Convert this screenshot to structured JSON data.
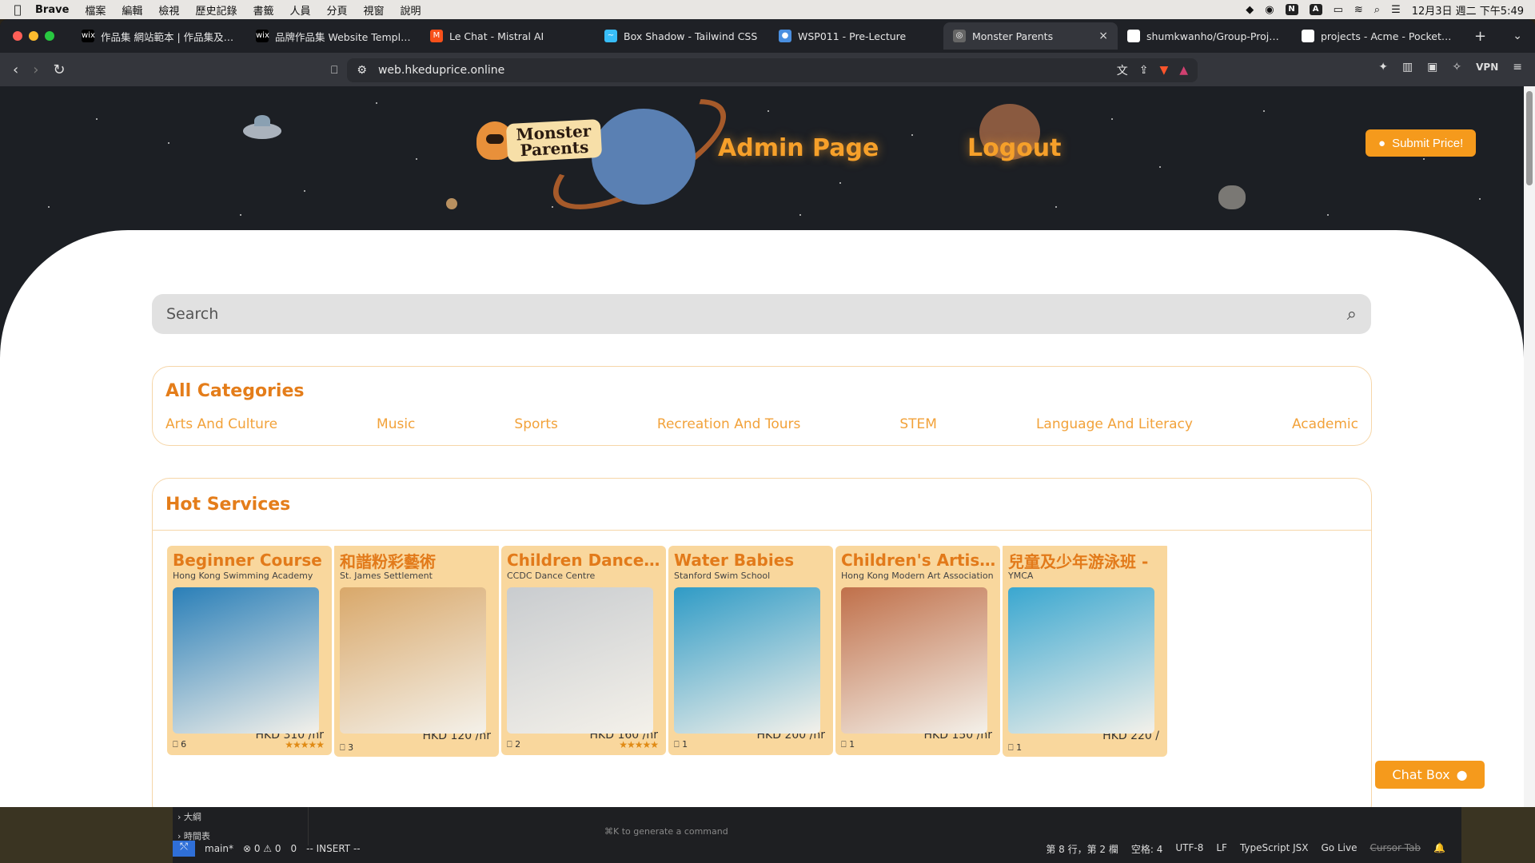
{
  "menubar": {
    "app": "Brave",
    "items": [
      "檔案",
      "編輯",
      "檢視",
      "歷史記錄",
      "書籤",
      "人員",
      "分頁",
      "視窗",
      "說明"
    ],
    "datetime": "12月3日 週二 下午5:49"
  },
  "tabs": [
    {
      "title": "作品集 網站範本 | 作品集及圖形",
      "fav": "wix",
      "color": "#000000"
    },
    {
      "title": "品牌作品集 Website Template",
      "fav": "wix",
      "color": "#000000"
    },
    {
      "title": "Le Chat - Mistral AI",
      "fav": "M",
      "color": "#f7501a"
    },
    {
      "title": "Box Shadow - Tailwind CSS",
      "fav": "~",
      "color": "#38bdf8"
    },
    {
      "title": "WSP011 - Pre-Lecture",
      "fav": "●",
      "color": "#4a8fe0"
    },
    {
      "title": "Monster Parents",
      "fav": "◎",
      "color": "#666666",
      "active": true
    },
    {
      "title": "shumkwanho/Group-Project-",
      "fav": "●",
      "color": "#ffffff"
    },
    {
      "title": "projects - Acme - PocketBase",
      "fav": "▣",
      "color": "#ffffff"
    }
  ],
  "url": "web.hkeduprice.online",
  "toolbar": {
    "vpn": "VPN"
  },
  "site": {
    "logo_line1": "Monster",
    "logo_line2": "Parents",
    "admin": "Admin Page",
    "logout": "Logout",
    "submit": "Submit Price!",
    "search_placeholder": "Search",
    "categories_title": "All Categories",
    "categories": [
      "Arts And Culture",
      "Music",
      "Sports",
      "Recreation And Tours",
      "STEM",
      "Language And Literacy",
      "Academic"
    ],
    "hot_title": "Hot Services",
    "chat": "Chat Box"
  },
  "cards": [
    {
      "title": "Beginner Course",
      "provider": "Hong Kong Swimming Academy",
      "price": "HKD 310 /hr",
      "bookmarks": "6",
      "rating": 5,
      "img_color": "#2a7fb8"
    },
    {
      "title": "和諧粉彩藝術",
      "provider": "St. James Settlement",
      "price": "HKD 120 /hr",
      "bookmarks": "3",
      "rating": 0,
      "img_color": "#d9a86a"
    },
    {
      "title": "Children Dance Shor...",
      "provider": "CCDC Dance Centre",
      "price": "HKD 160 /hr",
      "bookmarks": "2",
      "rating": 5,
      "img_color": "#c9cccf"
    },
    {
      "title": "Water Babies",
      "provider": "Stanford Swim School",
      "price": "HKD 200 /hr",
      "bookmarks": "1",
      "rating": 0,
      "img_color": "#2f9bc6"
    },
    {
      "title": "Children's Artistic Elit...",
      "provider": "Hong Kong Modern Art Association",
      "price": "HKD 150 /hr",
      "bookmarks": "1",
      "rating": 0,
      "img_color": "#c0704a"
    },
    {
      "title": "兒童及少年游泳班 -",
      "provider": "YMCA",
      "price": "HKD 220 /",
      "bookmarks": "1",
      "rating": 0,
      "img_color": "#3aa7d0"
    }
  ],
  "vscode": {
    "outline": "大綱",
    "timeline": "時間表",
    "hint": "⌘K to generate a command",
    "branch": "main*",
    "problems": "⊗ 0 ⚠ 0",
    "ports": "0",
    "mode": "-- INSERT --",
    "position": "第 8 行，第 2 欄",
    "spaces": "空格: 4",
    "encoding": "UTF-8",
    "eol": "LF",
    "lang": "TypeScript JSX",
    "golive": "Go Live",
    "cursortab": "Cursor Tab"
  }
}
